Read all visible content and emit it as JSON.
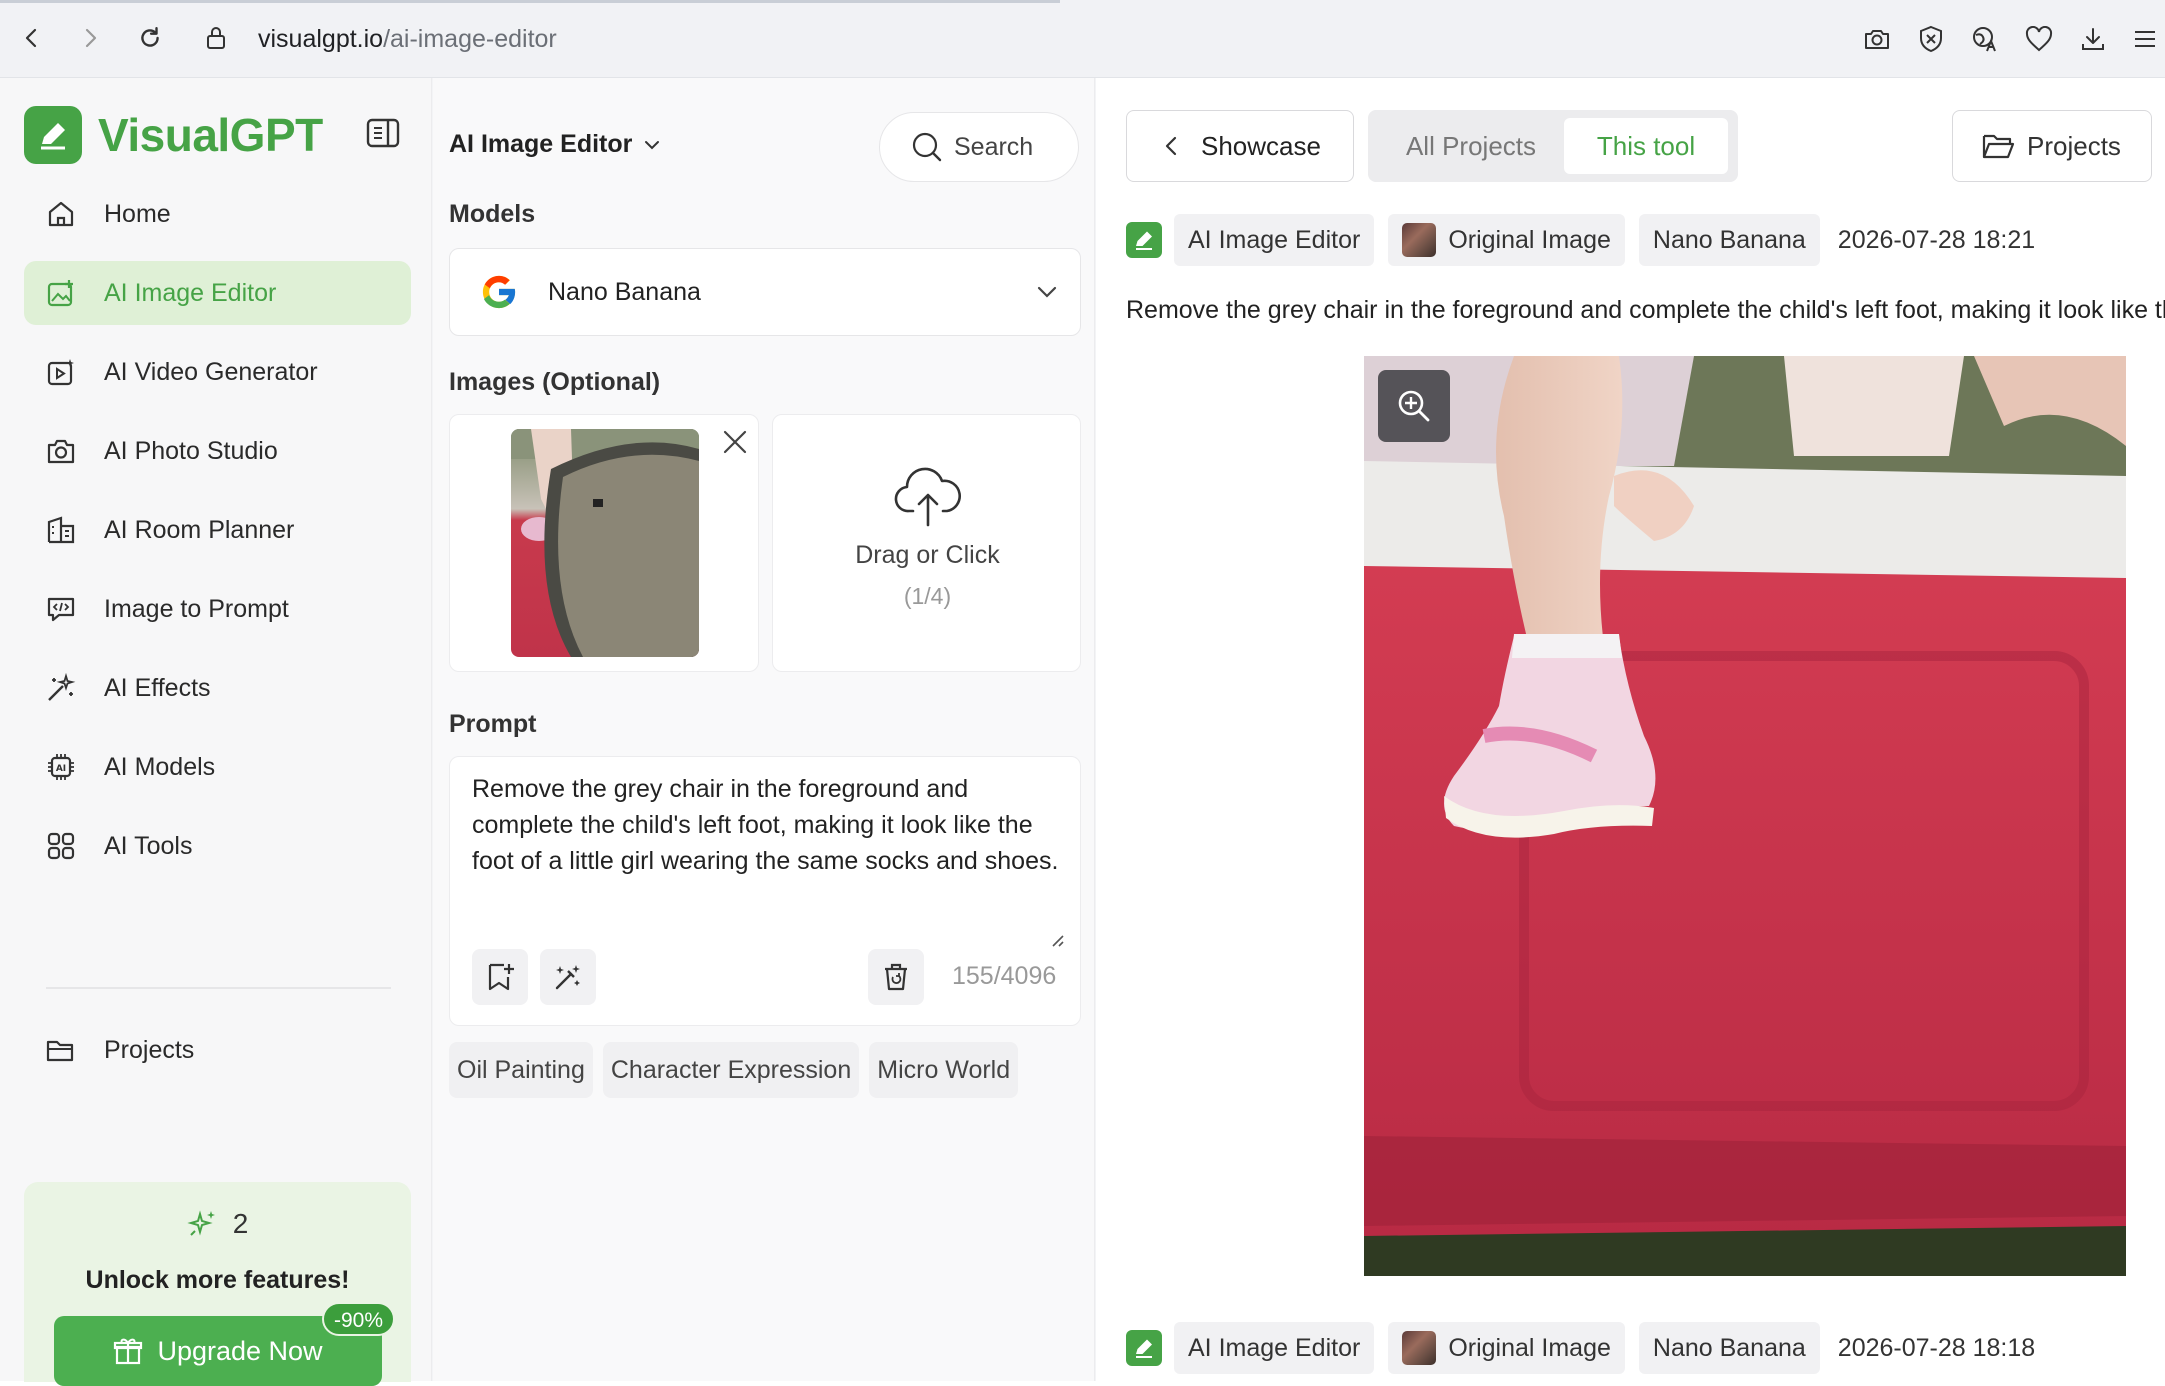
{
  "browser": {
    "url_host": "visualgpt.io",
    "url_path": "/ai-image-editor"
  },
  "sidebar": {
    "brand": "VisualGPT",
    "items": [
      {
        "label": "Home"
      },
      {
        "label": "AI Image Editor"
      },
      {
        "label": "AI Video Generator"
      },
      {
        "label": "AI Photo Studio"
      },
      {
        "label": "AI Room Planner"
      },
      {
        "label": "Image to Prompt"
      },
      {
        "label": "AI Effects"
      },
      {
        "label": "AI Models"
      },
      {
        "label": "AI Tools"
      }
    ],
    "projects_label": "Projects",
    "credits": "2",
    "unlock_text": "Unlock more features!",
    "upgrade_label": "Upgrade Now",
    "discount_badge": "-90%"
  },
  "mid": {
    "tool_title": "AI Image Editor",
    "search_label": "Search",
    "models_label": "Models",
    "model_name": "Nano Banana",
    "images_label": "Images (Optional)",
    "drop_text": "Drag or Click",
    "drop_count": "(1/4)",
    "prompt_label": "Prompt",
    "prompt_text": "Remove the grey chair in the foreground and complete the child's left foot, making it look like the foot of a little girl wearing the same socks and shoes.",
    "char_count": "155/4096",
    "chips": [
      "Oil Painting",
      "Character Expression",
      "Micro World"
    ]
  },
  "right": {
    "showcase_label": "Showcase",
    "tab_all": "All Projects",
    "tab_this": "This tool",
    "projects_label": "Projects",
    "entries": [
      {
        "tool": "AI Image Editor",
        "source": "Original Image",
        "model": "Nano Banana",
        "time": "2026-07-28 18:21",
        "prompt": "Remove the grey chair in the foreground and complete the child's left foot, making it look like the foot of a little girl wearing the same socks and shoes."
      },
      {
        "tool": "AI Image Editor",
        "source": "Original Image",
        "model": "Nano Banana",
        "time": "2026-07-28 18:18"
      }
    ]
  },
  "colors": {
    "brand_green": "#46a346",
    "active_bg": "#dff0d6",
    "upgrade_green": "#4caf50"
  },
  "icons": [
    "back-arrow-icon",
    "forward-arrow-icon",
    "reload-icon",
    "lock-icon",
    "camera-icon",
    "shield-icon",
    "translate-icon",
    "heart-icon",
    "download-icon",
    "menu-icon",
    "pencil-logo-icon",
    "sidebar-toggle-icon",
    "home-icon",
    "image-edit-icon",
    "video-icon",
    "camera-icon",
    "room-icon",
    "prompt-icon",
    "effects-icon",
    "ai-chip-icon",
    "grid-icon",
    "folder-icon",
    "sparkle-icon",
    "gift-icon",
    "chevron-down-icon",
    "search-icon",
    "google-icon",
    "close-icon",
    "cloud-upload-icon",
    "bookmark-add-icon",
    "magic-wand-icon",
    "trash-icon",
    "chevron-left-icon",
    "zoom-in-icon"
  ]
}
